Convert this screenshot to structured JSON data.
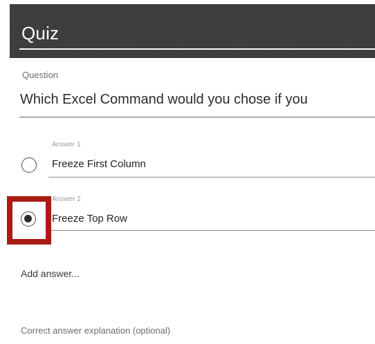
{
  "header": {
    "title": "Quiz"
  },
  "question": {
    "label": "Question",
    "text": "Which Excel Command would you chose if you"
  },
  "answers": [
    {
      "label": "Answer 1",
      "text": "Freeze First Column",
      "selected": false
    },
    {
      "label": "Answer 2",
      "text": "Freeze Top Row",
      "selected": true
    }
  ],
  "add_answer_label": "Add answer...",
  "explanation_label": "Correct answer explanation (optional)",
  "colors": {
    "header_bg": "#3c3c3c",
    "highlight": "#a91b13"
  }
}
